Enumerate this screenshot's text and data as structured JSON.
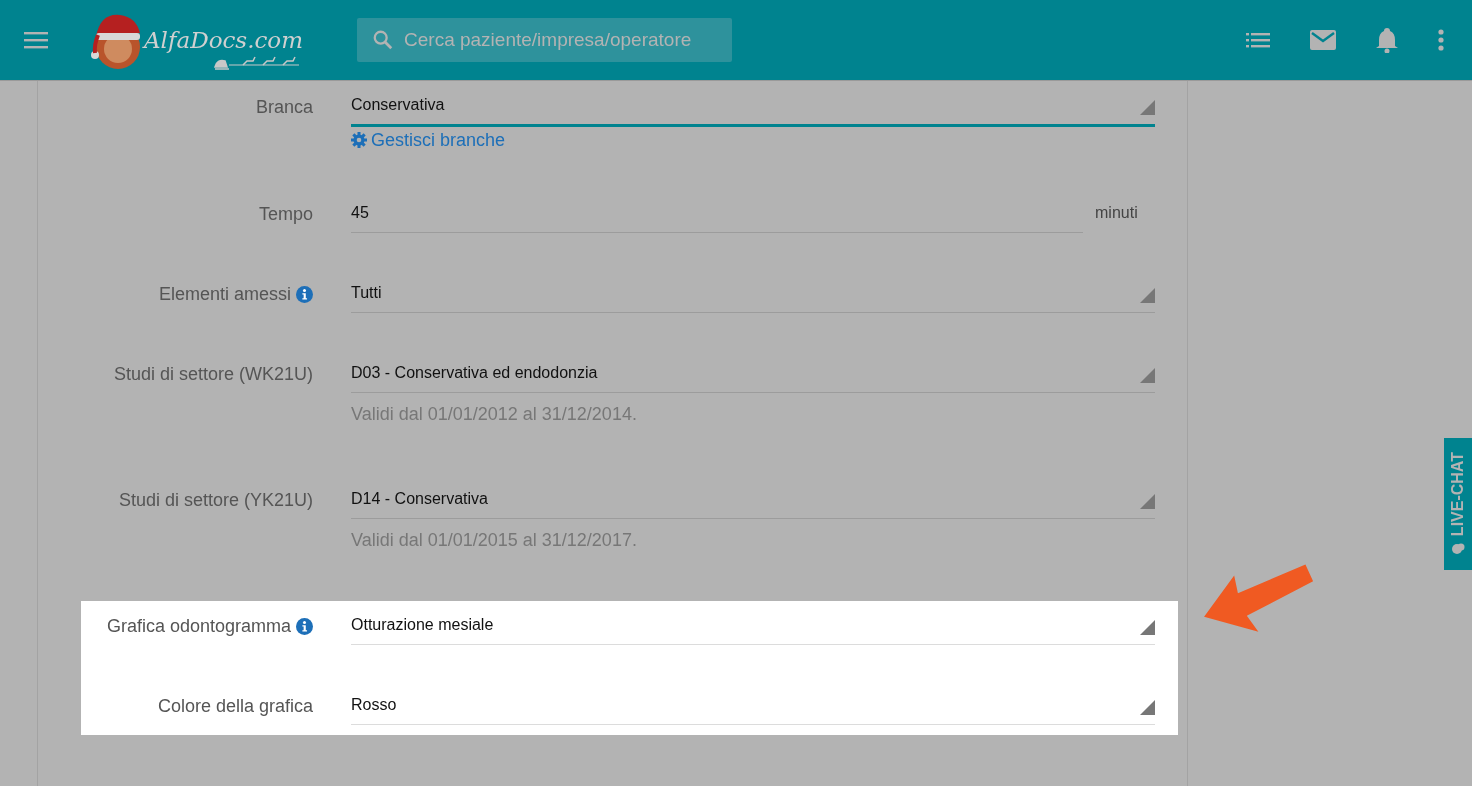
{
  "header": {
    "logo_text": "AlfaDocs.com",
    "search": {
      "placeholder": "Cerca paziente/impresa/operatore"
    }
  },
  "form": {
    "rows": [
      {
        "label": "Branca",
        "kind": "select",
        "value": "Conservativa",
        "focused": true,
        "info": false,
        "highlighted": false,
        "link": "Gestisci branche"
      },
      {
        "label": "Tempo",
        "kind": "text",
        "value": "45",
        "focused": false,
        "info": false,
        "highlighted": false,
        "unit": "minuti"
      },
      {
        "label": "Elementi amessi",
        "kind": "select",
        "value": "Tutti",
        "focused": false,
        "info": true,
        "highlighted": false
      },
      {
        "label": "Studi di settore (WK21U)",
        "kind": "select",
        "value": "D03 - Conservativa ed endodonzia",
        "focused": false,
        "info": false,
        "highlighted": false,
        "hint": "Validi dal 01/01/2012 al 31/12/2014."
      },
      {
        "label": "Studi di settore (YK21U)",
        "kind": "select",
        "value": "D14 - Conservativa",
        "focused": false,
        "info": false,
        "highlighted": false,
        "hint": "Validi dal 01/01/2015 al 31/12/2017."
      },
      {
        "label": "Grafica odontogramma",
        "kind": "select",
        "value": "Otturazione mesiale",
        "focused": false,
        "info": true,
        "highlighted": true
      },
      {
        "label": "Colore della grafica",
        "kind": "select",
        "value": "Rosso",
        "focused": false,
        "info": false,
        "highlighted": true
      }
    ]
  },
  "live_chat": {
    "label": "LIVE-CHAT"
  }
}
